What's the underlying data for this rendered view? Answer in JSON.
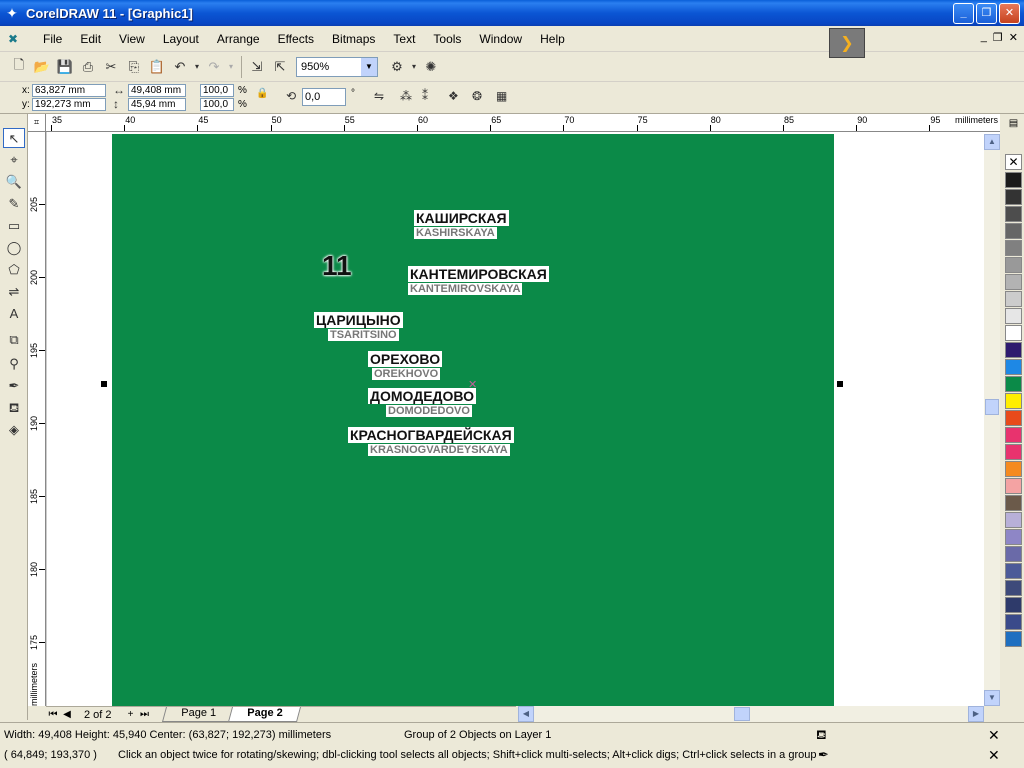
{
  "window": {
    "title": "CorelDRAW 11 - [Graphic1]",
    "minimize": "_",
    "maximize": "❐",
    "close": "✕"
  },
  "menu": {
    "items": [
      "File",
      "Edit",
      "View",
      "Layout",
      "Arrange",
      "Effects",
      "Bitmaps",
      "Text",
      "Tools",
      "Window",
      "Help"
    ]
  },
  "toolbar": {
    "zoom": "950%"
  },
  "propbar": {
    "x": "63,827 mm",
    "y": "192,273 mm",
    "width": "49,408 mm",
    "height": "45,94 mm",
    "scale_x": "100,0",
    "scale_y": "100,0",
    "pct1": "%",
    "pct2": "%",
    "rotation": "0,0",
    "deg": "°",
    "x_label": "x:",
    "y_label": "y:"
  },
  "ruler": {
    "units": "millimeters",
    "top_labels": [
      "35",
      "40",
      "45",
      "50",
      "55",
      "60",
      "65",
      "70",
      "75",
      "80",
      "85",
      "90",
      "95"
    ],
    "left_labels": [
      "205",
      "200",
      "195",
      "190",
      "185",
      "180",
      "175"
    ],
    "left_units": "millimeters"
  },
  "canvas": {
    "number_label": "11",
    "stations": [
      {
        "ru": "КАШИРСКАЯ",
        "en": "KASHIRSKAYA"
      },
      {
        "ru": "КАНТЕМИРОВСКАЯ",
        "en": "KANTEMIROVSKAYA"
      },
      {
        "ru": "ЦАРИЦЫНО",
        "en": "TSARITSINO"
      },
      {
        "ru": "ОРЕХОВО",
        "en": "OREKHOVO"
      },
      {
        "ru": "ДОМОДЕДОВО",
        "en": "DOMODEDOVO"
      },
      {
        "ru": "КРАСНОГВАРДЕЙСКАЯ",
        "en": "KRASNOGVARDEYSKAYA"
      }
    ],
    "background_color": "#0b8a48"
  },
  "pages": {
    "counter": "2 of 2",
    "tabs": [
      "Page 1",
      "Page 2"
    ],
    "active": "Page 2"
  },
  "status": {
    "dimensions": "Width: 49,408  Height: 45,940  Center: (63,827; 192,273)  millimeters",
    "object": "Group of 2 Objects on Layer 1",
    "cursor": "( 64,849; 193,370 )",
    "hint": "Click an object twice for rotating/skewing; dbl-clicking tool selects all objects; Shift+click multi-selects; Alt+click digs; Ctrl+click selects in a group"
  },
  "palette": [
    "#ffffff",
    "#000000",
    "#1a1a1a",
    "#333333",
    "#4d4d4d",
    "#666666",
    "#808080",
    "#999999",
    "#b3b3b3",
    "#cccccc",
    "#e6e6e6",
    "#ffffff",
    "#2e1a6e",
    "#1e88e5",
    "#0b8a48",
    "#ffee00",
    "#e84a1a",
    "#e8336e",
    "#e8336e",
    "#f58a1f",
    "#f4a3a3",
    "#6b5a4a",
    "#b8b0d8",
    "#8e86c6",
    "#6a6aa8",
    "#4c5a98",
    "#3e4a7a",
    "#2e3a6a",
    "#3a4a8a",
    "#1e6fc0"
  ]
}
